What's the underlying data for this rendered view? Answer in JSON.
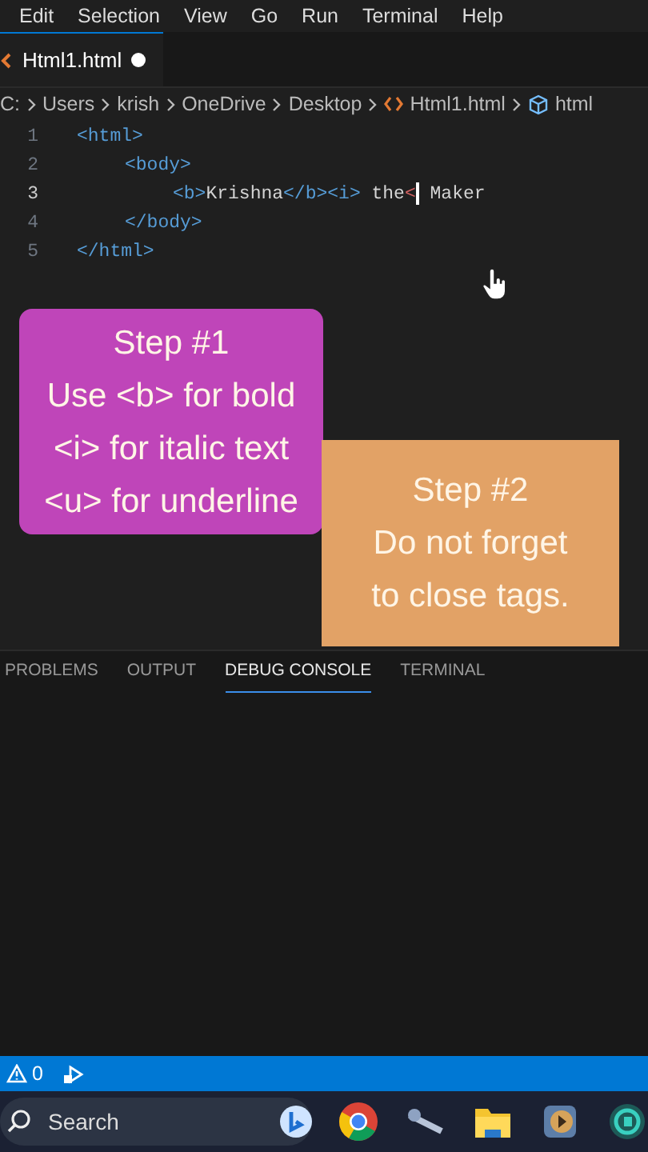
{
  "menu": [
    "Edit",
    "Selection",
    "View",
    "Go",
    "Run",
    "Terminal",
    "Help"
  ],
  "editor_tab": {
    "label": "Html1.html",
    "modified": true,
    "selected": true
  },
  "breadcrumb": [
    {
      "label": "C:",
      "kind": "folder"
    },
    {
      "label": "Users",
      "kind": "folder"
    },
    {
      "label": "krish",
      "kind": "folder"
    },
    {
      "label": "OneDrive",
      "kind": "folder"
    },
    {
      "label": "Desktop",
      "kind": "folder"
    },
    {
      "label": "Html1.html",
      "kind": "file"
    },
    {
      "label": "html",
      "kind": "element"
    }
  ],
  "code_lines": [
    {
      "number": "1",
      "active": false,
      "tokens": [
        {
          "kind": "tag",
          "text": "<html>"
        }
      ],
      "children": [
        {
          "number": "2",
          "active": false,
          "tokens": [
            {
              "kind": "tag",
              "text": "<body>"
            }
          ],
          "children": [
            {
              "number": "3",
              "active": true,
              "tokens": [
                {
                  "kind": "tag",
                  "text": "<b>"
                },
                {
                  "kind": "text",
                  "text": "Krishna"
                },
                {
                  "kind": "tag",
                  "text": "</b><i>"
                },
                {
                  "kind": "text",
                  "text": " the"
                },
                {
                  "kind": "error",
                  "text": "<"
                },
                {
                  "kind": "cursor"
                },
                {
                  "kind": "text",
                  "text": " Maker"
                }
              ]
            }
          ]
        },
        {
          "number": "4",
          "active": false,
          "tokens": [
            {
              "kind": "tag",
              "text": "</body>"
            }
          ]
        }
      ]
    },
    {
      "number": "5",
      "active": false,
      "tokens": [
        {
          "kind": "tag",
          "text": "</html>"
        }
      ]
    }
  ],
  "callouts": [
    {
      "title": "Step #1",
      "lines": [
        "Use <b> for bold",
        "<i> for italic text",
        "<u> for underline"
      ],
      "color": "#bf45b9"
    },
    {
      "title": "Step #2",
      "lines": [
        "Do not forget",
        "to close tags."
      ],
      "color": "#e2a266"
    }
  ],
  "panel_tabs": [
    {
      "label": "PROBLEMS",
      "selected": false
    },
    {
      "label": "OUTPUT",
      "selected": false
    },
    {
      "label": "DEBUG CONSOLE",
      "selected": true
    },
    {
      "label": "TERMINAL",
      "selected": false
    }
  ],
  "status_bar": {
    "warnings": "0"
  },
  "taskbar": {
    "search": {
      "placeholder": "Search"
    }
  }
}
